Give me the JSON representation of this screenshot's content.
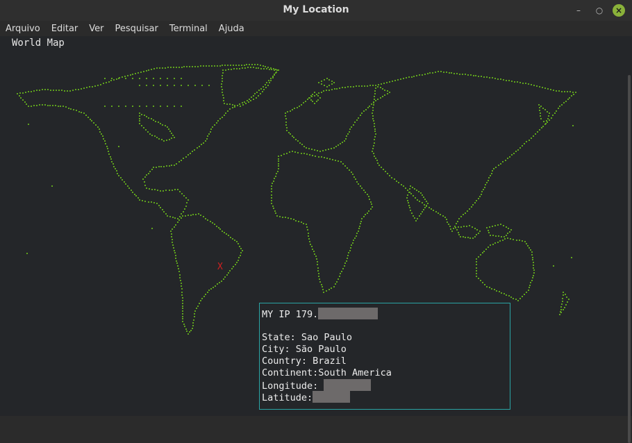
{
  "window": {
    "title": "My Location"
  },
  "menu": {
    "items": [
      "Arquivo",
      "Editar",
      "Ver",
      "Pesquisar",
      "Terminal",
      "Ajuda"
    ]
  },
  "terminal": {
    "map_title": "World Map",
    "marker": "X",
    "info": {
      "ip_label": "MY IP 179.",
      "state": "State: Sao Paulo",
      "city": "City: São Paulo",
      "country": "Country: Brazil",
      "continent": "Continent:South America",
      "longitude_label": "Longitude: ",
      "latitude_label": "Latitude:"
    }
  },
  "colors": {
    "map_dots": "#5fa31e",
    "marker": "#d02020",
    "box_border": "#2aa5a5"
  }
}
